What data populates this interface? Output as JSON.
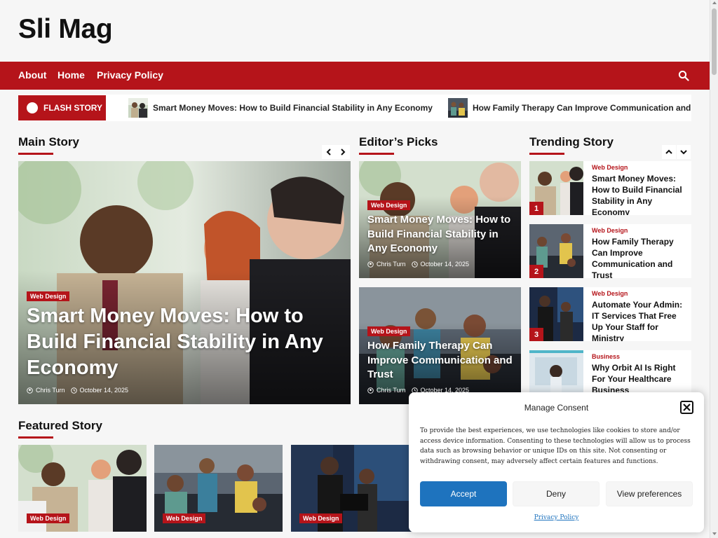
{
  "site": {
    "title": "Sli Mag"
  },
  "nav": {
    "items": [
      "About",
      "Home",
      "Privacy Policy"
    ]
  },
  "flash": {
    "label": "FLASH STORY",
    "items": [
      "Smart Money Moves: How to Build Financial Stability in Any Economy",
      "How Family Therapy Can Improve Communication and Trust"
    ]
  },
  "sections": {
    "main": "Main Story",
    "editors": "Editor’s Picks",
    "trending": "Trending Story",
    "featured": "Featured Story"
  },
  "main_story": {
    "category": "Web Design",
    "title": "Smart Money Moves: How to Build Financial Stability in Any Economy",
    "author": "Chris Turn",
    "date": "October 14, 2025"
  },
  "editors": [
    {
      "category": "Web Design",
      "title": "Smart Money Moves: How to Build Financial Stability in Any Economy",
      "author": "Chris Turn",
      "date": "October 14, 2025"
    },
    {
      "category": "Web Design",
      "title": "How Family Therapy Can Improve Communication and Trust",
      "author": "Chris Turn",
      "date": "October 14, 2025"
    }
  ],
  "trending": [
    {
      "rank": "1",
      "category": "Web Design",
      "title": "Smart Money Moves: How to Build Financial Stability in Any Economy"
    },
    {
      "rank": "2",
      "category": "Web Design",
      "title": "How Family Therapy Can Improve Communication and Trust"
    },
    {
      "rank": "3",
      "category": "Web Design",
      "title": "Automate Your Admin: IT Services That Free Up Your Staff for Ministry"
    },
    {
      "rank": "",
      "category": "Business",
      "title": "Why Orbit AI Is Right For Your Healthcare Business"
    }
  ],
  "featured": [
    {
      "category": "Web Design"
    },
    {
      "category": "Web Design"
    },
    {
      "category": "Web Design"
    }
  ],
  "consent": {
    "title": "Manage Consent",
    "body": "To provide the best experiences, we use technologies like cookies to store and/or access device information. Consenting to these technologies will allow us to process data such as browsing behavior or unique IDs on this site. Not consenting or withdrawing consent, may adversely affect certain features and functions.",
    "accept": "Accept",
    "deny": "Deny",
    "view": "View preferences",
    "privacy": "Privacy Policy"
  },
  "colors": {
    "accent": "#b5141a",
    "button_blue": "#1e73be"
  }
}
